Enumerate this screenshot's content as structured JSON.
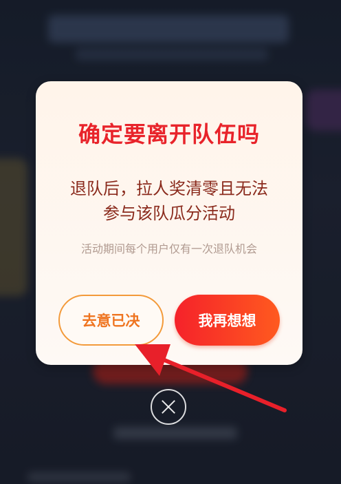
{
  "dialog": {
    "title": "确定要离开队伍吗",
    "message": "退队后，拉人奖清零且无法参与该队瓜分活动",
    "note": "活动期间每个用户仅有一次退队机会",
    "leave_button_label": "去意已决",
    "stay_button_label": "我再想想"
  },
  "icons": {
    "close": "close-circle-icon",
    "annotation": "red-arrow-pointer"
  },
  "colors": {
    "title": "#e8232a",
    "message": "#8a2a1c",
    "leave_border": "#f39a3a",
    "leave_text": "#ef7420",
    "stay_gradient_start": "#f5222a",
    "stay_gradient_end": "#ff5a1f",
    "annotation_arrow": "#e8202a"
  }
}
